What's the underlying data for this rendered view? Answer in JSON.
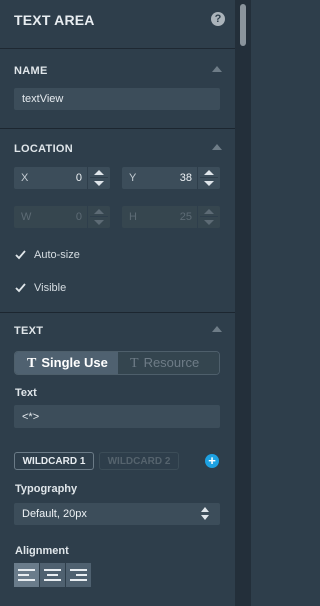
{
  "header": {
    "title": "TEXT AREA"
  },
  "sections": {
    "name": {
      "title": "NAME",
      "value": "textView"
    },
    "location": {
      "title": "LOCATION",
      "x": {
        "label": "X",
        "value": "0"
      },
      "y": {
        "label": "Y",
        "value": "38"
      },
      "w": {
        "label": "W",
        "value": "0"
      },
      "h": {
        "label": "H",
        "value": "25"
      },
      "autosize_label": "Auto-size",
      "visible_label": "Visible"
    },
    "text": {
      "title": "TEXT",
      "mode_single": "Single Use",
      "mode_resource": "Resource",
      "text_label": "Text",
      "text_value": "<*>",
      "wildcard_1": "WILDCARD 1",
      "wildcard_2": "WILDCARD 2",
      "typography_label": "Typography",
      "typography_value": "Default, 20px",
      "alignment_label": "Alignment"
    }
  },
  "icons": {
    "help": "?",
    "add": "+",
    "t_glyph": "T"
  },
  "colors": {
    "panel_bg": "#2e3e4b",
    "field_bg": "#3c4d5a",
    "accent": "#1da1e2"
  }
}
